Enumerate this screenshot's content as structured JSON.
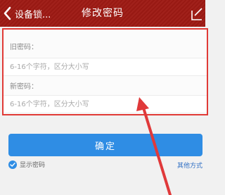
{
  "header": {
    "back_label": "设备锁...",
    "title": "修改密码",
    "back_icon": "chevron-left-icon",
    "edit_icon": "edit-icon"
  },
  "form": {
    "old_password_label": "旧密码：",
    "old_password_placeholder": "6-16个字符，区分大小写",
    "old_password_value": "",
    "new_password_label": "新密码：",
    "new_password_placeholder": "6-16个字符，区分大小写",
    "new_password_value": ""
  },
  "actions": {
    "confirm_label": "确定",
    "show_password_label": "显示密码",
    "show_password_checked": true,
    "other_methods_label": "其他方式"
  },
  "colors": {
    "header_bg": "#9e1a14",
    "highlight_border": "#e03a36",
    "primary_button": "#2f8de4",
    "link": "#2f6fc4",
    "annotation_arrow": "#e0393a"
  }
}
